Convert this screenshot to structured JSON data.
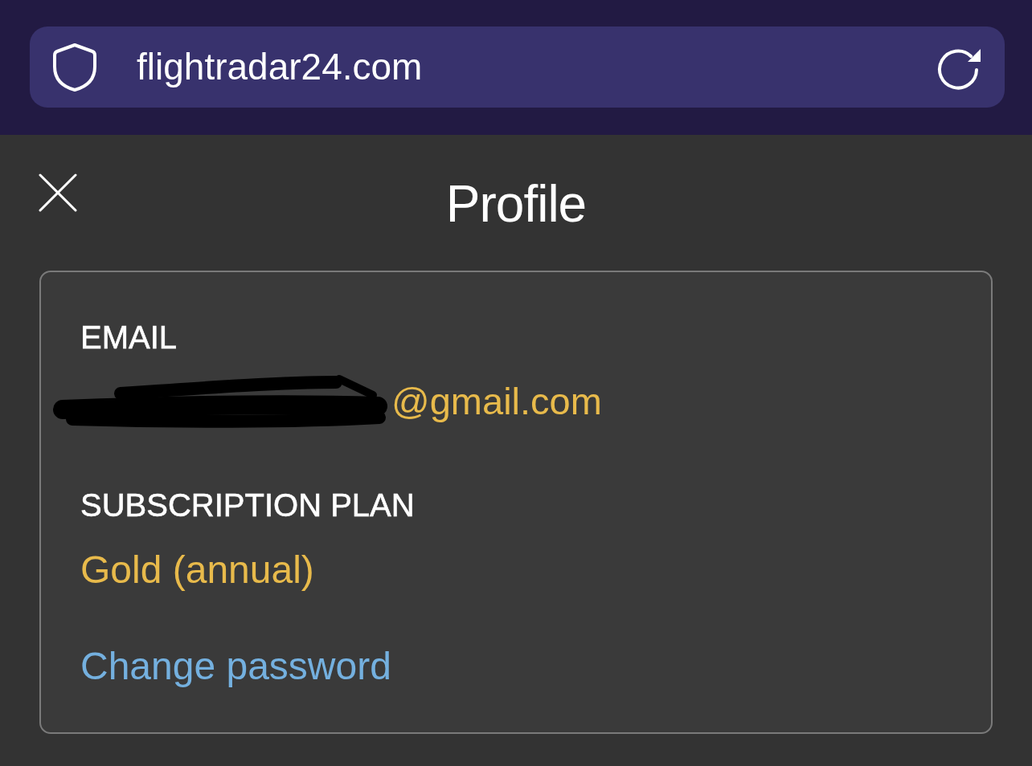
{
  "browser": {
    "url": "flightradar24.com"
  },
  "page": {
    "title": "Profile"
  },
  "profile": {
    "fields": [
      {
        "label": "EMAIL",
        "value": "@gmail.com",
        "redacted": true
      },
      {
        "label": "SUBSCRIPTION PLAN",
        "value": "Gold (annual)",
        "redacted": false
      }
    ],
    "link": "Change password"
  }
}
